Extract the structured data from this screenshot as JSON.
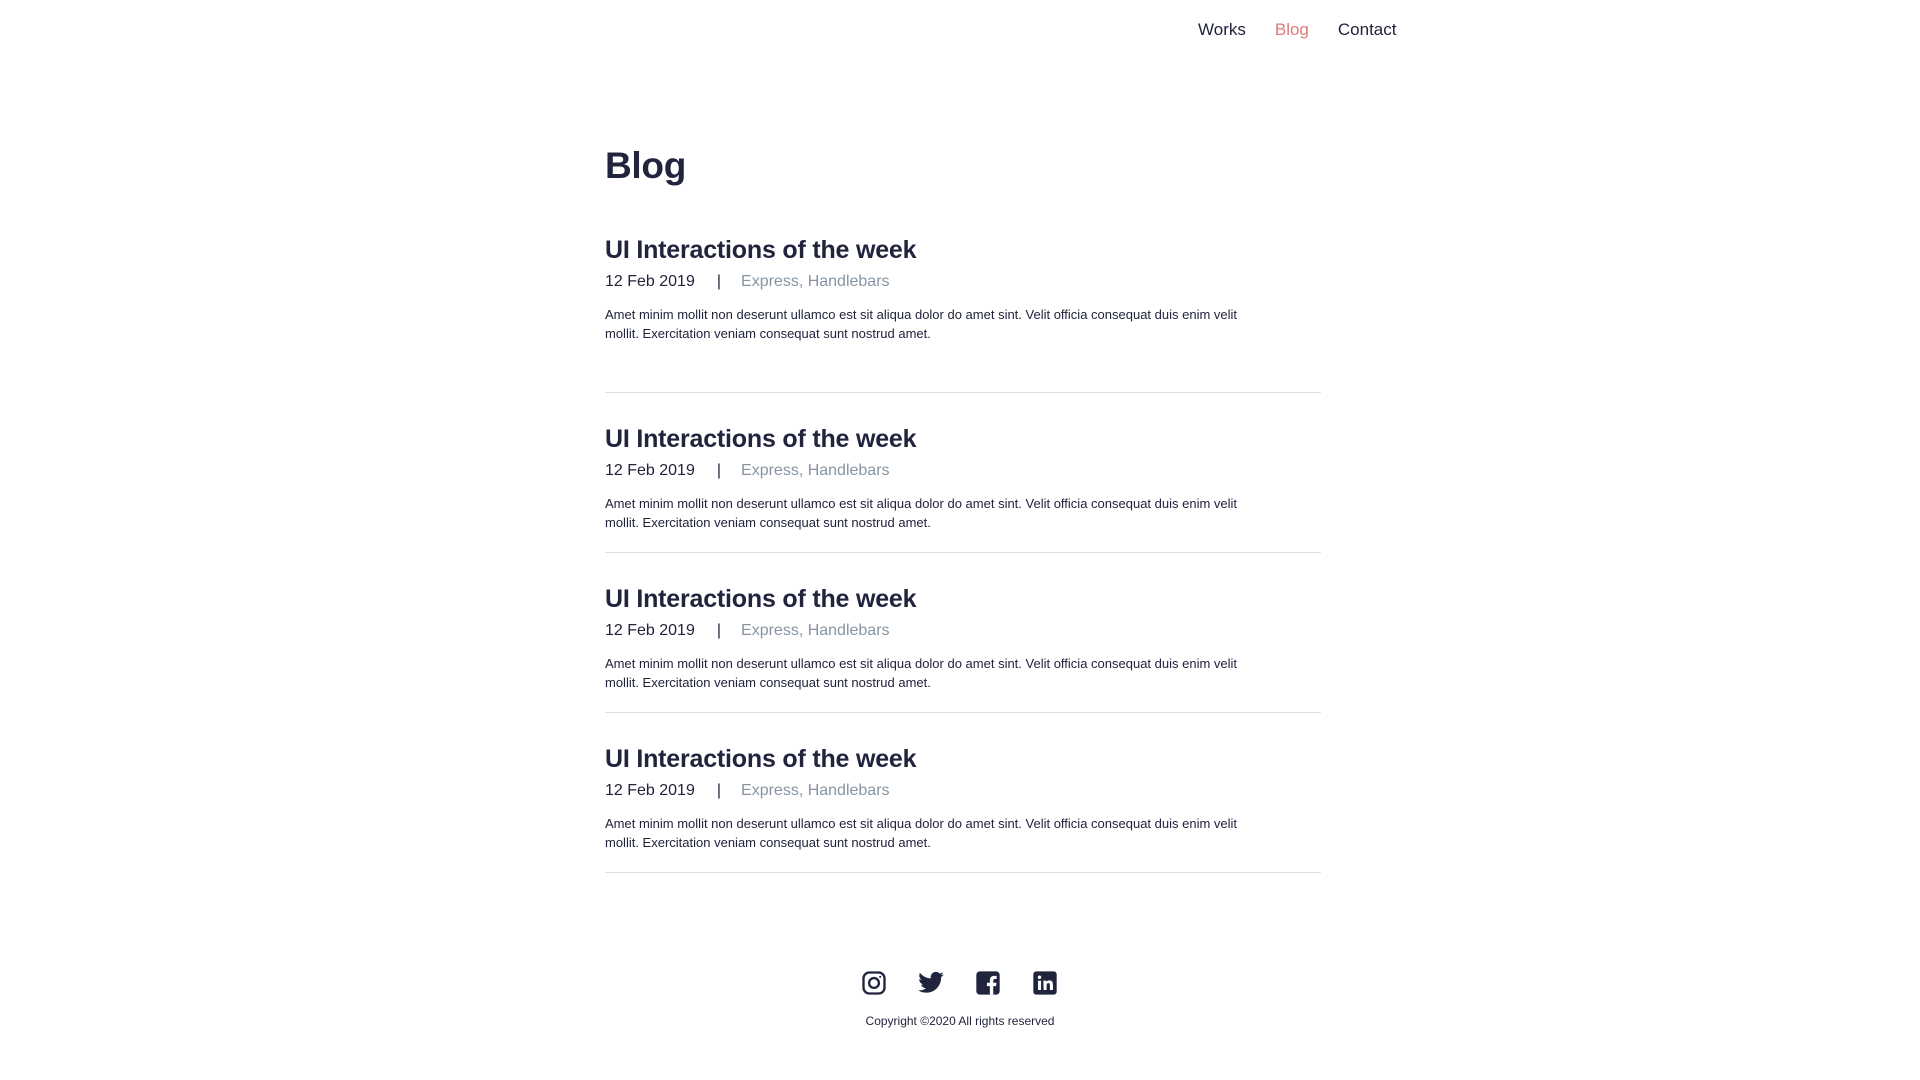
{
  "nav": {
    "items": [
      {
        "label": "Works",
        "active": false
      },
      {
        "label": "Blog",
        "active": true
      },
      {
        "label": "Contact",
        "active": false
      }
    ],
    "active_color": "#e07a7a"
  },
  "main": {
    "title": "Blog",
    "posts": [
      {
        "title": "UI Interactions of the week",
        "date": "12 Feb 2019",
        "separator": "|",
        "tags": "Express, Handlebars",
        "excerpt": "Amet minim mollit non deserunt ullamco est sit aliqua dolor do amet sint. Velit officia consequat duis enim velit mollit. Exercitation veniam consequat sunt nostrud amet."
      },
      {
        "title": "UI Interactions of the week",
        "date": "12 Feb 2019",
        "separator": "|",
        "tags": "Express, Handlebars",
        "excerpt": "Amet minim mollit non deserunt ullamco est sit aliqua dolor do amet sint. Velit officia consequat duis enim velit mollit. Exercitation veniam consequat sunt nostrud amet."
      },
      {
        "title": "UI Interactions of the week",
        "date": "12 Feb 2019",
        "separator": "|",
        "tags": "Express, Handlebars",
        "excerpt": "Amet minim mollit non deserunt ullamco est sit aliqua dolor do amet sint. Velit officia consequat duis enim velit mollit. Exercitation veniam consequat sunt nostrud amet."
      },
      {
        "title": "UI Interactions of the week",
        "date": "12 Feb 2019",
        "separator": "|",
        "tags": "Express, Handlebars",
        "excerpt": "Amet minim mollit non deserunt ullamco est sit aliqua dolor do amet sint. Velit officia consequat duis enim velit mollit. Exercitation veniam consequat sunt nostrud amet."
      }
    ]
  },
  "footer": {
    "socials": [
      "instagram-icon",
      "twitter-icon",
      "facebook-icon",
      "linkedin-icon"
    ],
    "copyright": "Copyright ©2020 All rights reserved"
  },
  "colors": {
    "text": "#21243d",
    "muted": "#8695a4",
    "accent": "#e07a7a",
    "divider": "#e0e0e0"
  }
}
